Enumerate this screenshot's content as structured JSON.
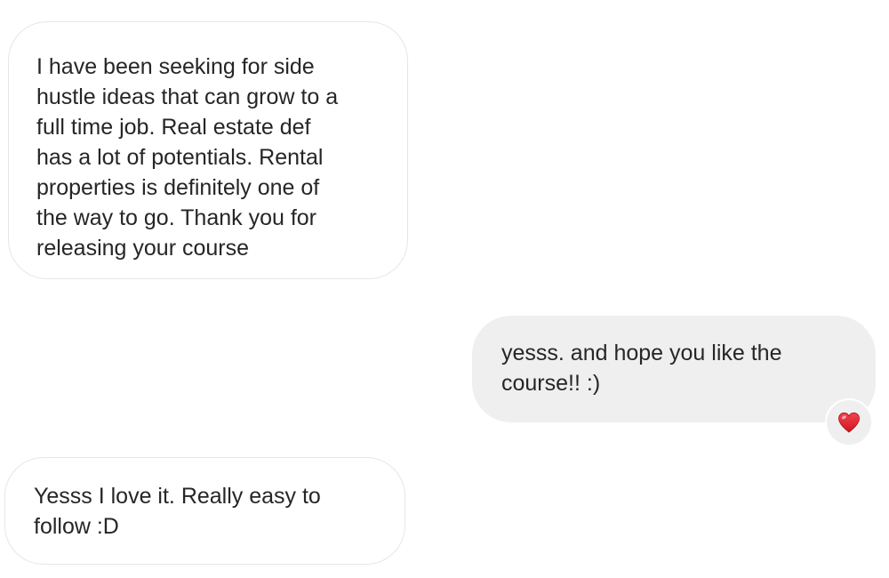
{
  "conversation": {
    "messages": [
      {
        "direction": "incoming",
        "text": "I have been seeking for side\nhustle ideas that can grow to a\nfull time job. Real estate def\nhas a lot of potentials. Rental\nproperties is definitely one of\nthe way to go. Thank you for\nreleasing your course"
      },
      {
        "direction": "outgoing",
        "text": "yesss. and hope you like the\ncourse!! :)",
        "reaction": "heart-icon"
      },
      {
        "direction": "incoming",
        "text": "Yesss I love it. Really easy to\nfollow :D"
      }
    ]
  },
  "colors": {
    "incoming_bubble": "#ffffff",
    "incoming_border": "#e6e6e6",
    "outgoing_bubble": "#efefef",
    "text": "#262626",
    "heart": "#e0202c"
  }
}
